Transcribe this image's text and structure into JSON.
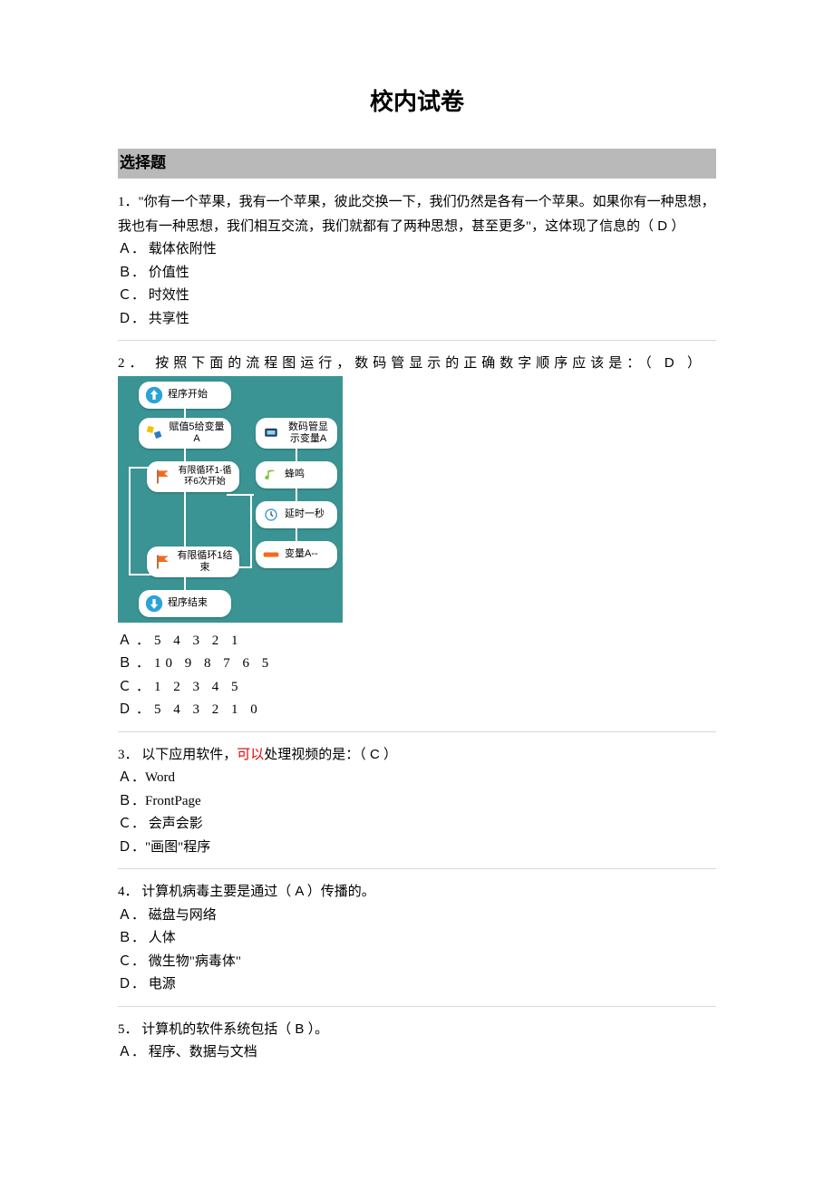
{
  "title": "校内试卷",
  "section": "选择题",
  "questions": [
    {
      "num": "1",
      "prompt_pre": "．\"你有一个苹果，我有一个苹果，彼此交换一下，我们仍然是各有一个苹果。如果你有一种思想，我也有一种思想，我们相互交流，我们就都有了两种思想，甚至更多\"，这体现了信息的（",
      "answer": " D ",
      "prompt_post": "）",
      "opts": [
        "Ａ． 载体依附性",
        "Ｂ． 价值性",
        "Ｃ． 时效性",
        "Ｄ． 共享性"
      ]
    },
    {
      "num": "2",
      "prompt_pre": "． 按照下面的流程图运行，数码管显示的正确数字顺序应该是：（",
      "answer": " D ",
      "prompt_post": "）",
      "flow_nodes": {
        "start": "程序开始",
        "assign": "赋值5给变量A",
        "loop_open": "有限循环1-循环6次开始",
        "loop_close": "有限循环1结束",
        "end": "程序结束",
        "display": "数码管显示变量A",
        "buzz": "蜂鸣",
        "delay": "延时一秒",
        "decr": "变量A--"
      },
      "opts": [
        "Ａ．5 4 3 2 1",
        "Ｂ．10 9 8 7 6 5",
        "Ｃ．1 2 3 4 5",
        "Ｄ．5 4 3 2 1 0"
      ]
    },
    {
      "num": "3",
      "prompt_pre": "． 以下应用软件，",
      "red": "可以",
      "prompt_mid": "处理视频的是：（",
      "answer": " C ",
      "prompt_post": "）",
      "opts": [
        "Ａ．Word",
        "Ｂ．FrontPage",
        "Ｃ． 会声会影",
        "Ｄ．\"画图\"程序"
      ]
    },
    {
      "num": "4",
      "prompt_pre": "． 计算机病毒主要是通过（",
      "answer": " A ",
      "prompt_post": "）传播的。",
      "opts": [
        "Ａ． 磁盘与网络",
        "Ｂ． 人体",
        "Ｃ． 微生物\"病毒体\"",
        "Ｄ． 电源"
      ]
    },
    {
      "num": "5",
      "prompt_pre": "． 计算机的软件系统包括（",
      "answer": " B  ",
      "prompt_post": "）。",
      "opts": [
        "Ａ． 程序、数据与文档"
      ]
    }
  ]
}
